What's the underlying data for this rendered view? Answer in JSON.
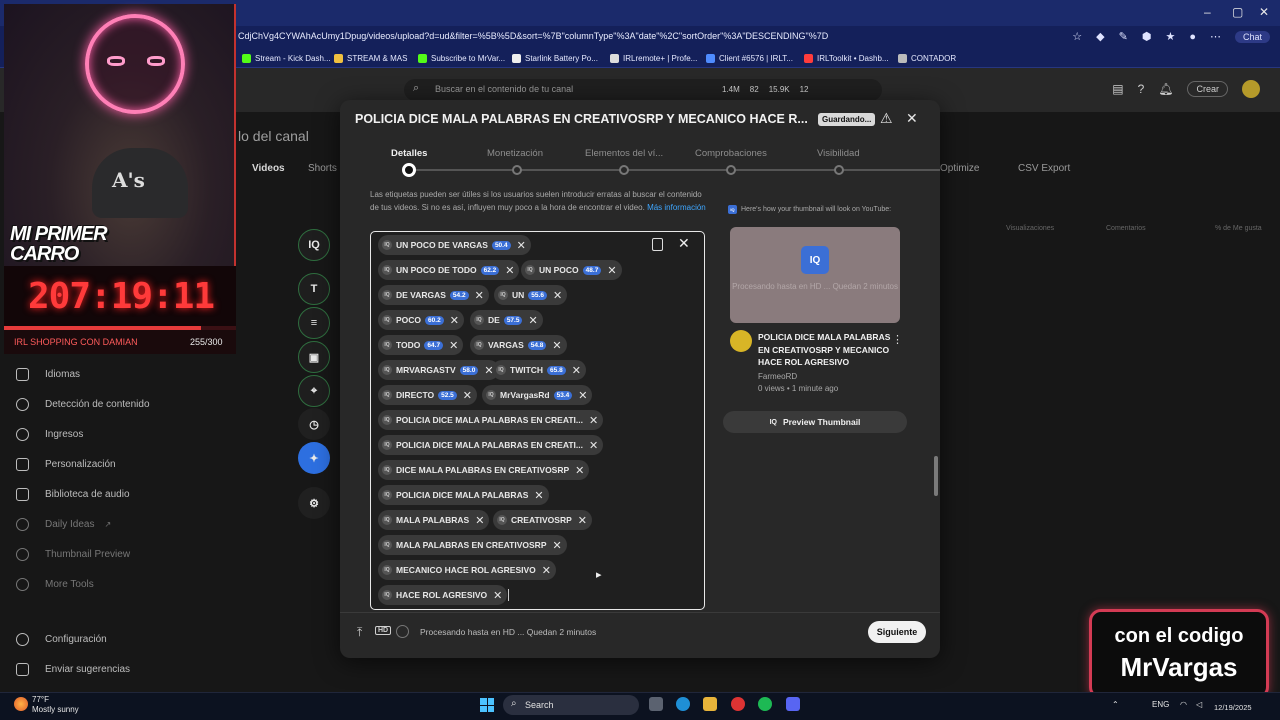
{
  "browser": {
    "url": "CdjChVg4CYWAhAcUmy1Dpug/videos/upload?d=ud&filter=%5B%5D&sort=%7B\"columnType\"%3A\"date\"%2C\"sortOrder\"%3A\"DESCENDING\"%7D",
    "copilot_label": "Chat",
    "bookmarks": [
      "Stream - Kick Dash...",
      "STREAM & MAS",
      "Subscribe to MrVar...",
      "Starlink Battery Po...",
      "IRLremote+ | Profe...",
      "Client #6576 | IRLT...",
      "IRLToolkit • Dashb...",
      "CONTADOR"
    ]
  },
  "yt": {
    "search_placeholder": "Buscar en el contenido de tu canal",
    "stats": [
      "1.4M",
      "82",
      "15.9K",
      "12"
    ],
    "crear_label": "Crear",
    "canal_title": "lo del canal",
    "tabs": [
      "Videos",
      "Shorts"
    ],
    "right_tabs": [
      "Optimize",
      "CSV Export"
    ],
    "columns": [
      "Visualizaciones",
      "Comentarios",
      "% de Me gusta"
    ]
  },
  "sidebar": {
    "items": [
      "Idiomas",
      "Detección de contenido",
      "Ingresos",
      "Personalización",
      "Biblioteca de audio",
      "Daily Ideas",
      "Thumbnail Preview",
      "More Tools"
    ],
    "bottom": [
      "Configuración",
      "Enviar sugerencias"
    ]
  },
  "overlay": {
    "title_text": "MI PRIMER CARRO",
    "timer": "207:19:11",
    "goal_label": "IRL SHOPPING CON DAMIAN",
    "goal_count": "255/300",
    "goal_progress": 0.85,
    "code_line1": "con el codigo",
    "code_line2": "MrVargas"
  },
  "modal": {
    "title": "POLICIA DICE MALA PALABRAS EN CREATIVOSRP Y MECANICO HACE R...",
    "saving_label": "Guardando...",
    "steps": [
      "Detalles",
      "Monetización",
      "Elementos del ví...",
      "Comprobaciones",
      "Visibilidad"
    ],
    "help_text": "Las etiquetas pueden ser útiles si los usuarios suelen introducir erratas al buscar el contenido de tus videos. Si no es así, influyen muy poco a la hora de encontrar el video.",
    "help_link": "Más información",
    "tags": [
      {
        "text": "UN POCO DE VARGAS",
        "score": "50.4"
      },
      {
        "text": "UN POCO DE TODO",
        "score": "62.2"
      },
      {
        "text": "UN POCO",
        "score": "48.7"
      },
      {
        "text": "DE VARGAS",
        "score": "54.2"
      },
      {
        "text": "UN",
        "score": "55.6"
      },
      {
        "text": "POCO",
        "score": "60.2"
      },
      {
        "text": "DE",
        "score": "57.5"
      },
      {
        "text": "TODO",
        "score": "64.7"
      },
      {
        "text": "VARGAS",
        "score": "54.8"
      },
      {
        "text": "MRVARGASTV",
        "score": "58.0"
      },
      {
        "text": "TWITCH",
        "score": "65.8"
      },
      {
        "text": "DIRECTO",
        "score": "52.5"
      },
      {
        "text": "MrVargasRd",
        "score": "53.4"
      },
      {
        "text": "POLICIA DICE MALA PALABRAS EN CREATI...",
        "score": ""
      },
      {
        "text": "POLICIA DICE MALA PALABRAS EN CREATI...",
        "score": ""
      },
      {
        "text": "DICE MALA PALABRAS EN CREATIVOSRP",
        "score": ""
      },
      {
        "text": "POLICIA DICE MALA PALABRAS",
        "score": ""
      },
      {
        "text": "MALA PALABRAS",
        "score": ""
      },
      {
        "text": "CREATIVOSRP",
        "score": ""
      },
      {
        "text": "MALA PALABRAS EN CREATIVOSRP",
        "score": ""
      },
      {
        "text": "MECANICO HACE ROL AGRESIVO",
        "score": ""
      },
      {
        "text": "HACE ROL AGRESIVO",
        "score": ""
      }
    ],
    "iq_chip_label": "IQ",
    "thumb_hint": "Here's how your thumbnail will look on YouTube:",
    "thumb_processing": "Procesando hasta en HD ... Quedan 2 minutos",
    "video_title": "POLICIA DICE MALA PALABRAS EN CREATIVOSRP Y MECANICO HACE ROL AGRESIVO",
    "channel": "FarmeoRD",
    "meta": "0 views • 1 minute ago",
    "preview_btn": "Preview Thumbnail",
    "footer_status": "Procesando hasta en HD ... Quedan 2 minutos",
    "next_label": "Siguiente",
    "hd_label": "HD"
  },
  "taskbar": {
    "temp": "77°F",
    "weather": "Mostly sunny",
    "search": "Search",
    "lang": "ENG",
    "date": "12/19/2025"
  }
}
